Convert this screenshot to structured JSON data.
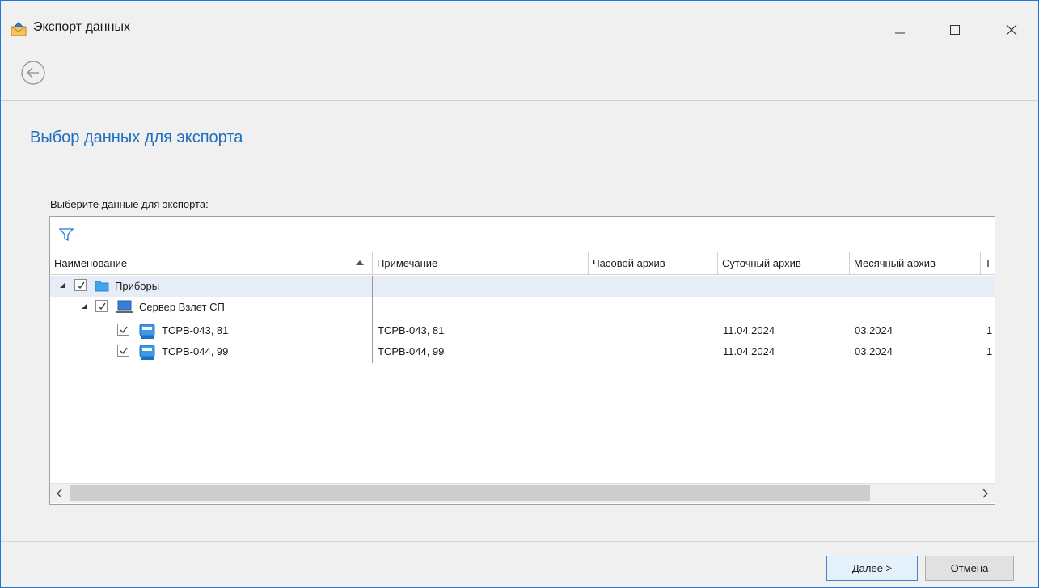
{
  "window": {
    "title": "Экспорт данных",
    "app_icon": "export-envelope-icon",
    "controls": [
      "minimize-icon",
      "maximize-icon",
      "close-icon"
    ],
    "accent_color": "#1e7ad6"
  },
  "navigation": {
    "back_icon": "back-arrow-icon"
  },
  "page": {
    "title": "Выбор данных для экспорта",
    "title_color": "#1f6fc0",
    "prompt": "Выберите данные для экспорта:"
  },
  "grid": {
    "filter_icon": "filter-icon",
    "sort_column": "Наименование",
    "sort_direction": "ascending",
    "columns": [
      "Наименование",
      "Примечание",
      "Часовой архив",
      "Суточный архив",
      "Месячный архив",
      "Т"
    ],
    "rows": [
      {
        "name": "Приборы",
        "icon": "folder-icon",
        "checked": true,
        "expanded": true,
        "note": "",
        "hourly": "",
        "daily": "",
        "monthly": "",
        "extra": "",
        "selected": true
      },
      {
        "name": "Сервер Взлет СП",
        "icon": "server-computer-icon",
        "checked": true,
        "expanded": true,
        "note": "",
        "hourly": "",
        "daily": "",
        "monthly": "",
        "extra": "",
        "selected": false
      },
      {
        "name": "TCPB-043, 81",
        "icon": "meter-device-icon",
        "checked": true,
        "expanded": false,
        "note": "TCPB-043, 81",
        "hourly": "",
        "daily": "11.04.2024",
        "monthly": "03.2024",
        "extra": "1",
        "selected": false
      },
      {
        "name": "TCPB-044, 99",
        "icon": "meter-device-icon",
        "checked": true,
        "expanded": false,
        "note": "TCPB-044, 99",
        "hourly": "",
        "daily": "11.04.2024",
        "monthly": "03.2024",
        "extra": "1",
        "selected": false
      }
    ],
    "horizontal_scroll": {
      "left_icon": "chevron-left-icon",
      "right_icon": "chevron-right-icon"
    }
  },
  "buttons": {
    "next": "Далее >",
    "cancel": "Отмена"
  }
}
